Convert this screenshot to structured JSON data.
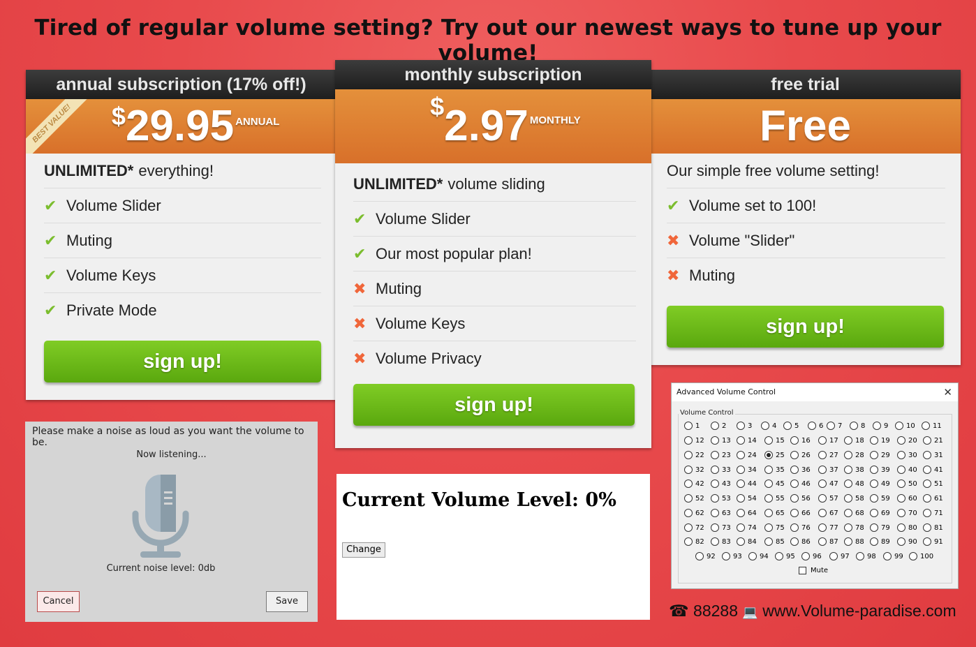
{
  "headline": "Tired of regular volume setting? Try out our newest ways to tune up your volume!",
  "plans": {
    "annual": {
      "title": "annual subscription (17% off!)",
      "currency": "$",
      "amount": "29.95",
      "period": "ANNUAL",
      "ribbon": "BEST VALUE!",
      "intro_bold": "UNLIMITED*",
      "intro_rest": "everything!",
      "features": [
        {
          "icon": "check",
          "label": "Volume Slider"
        },
        {
          "icon": "check",
          "label": "Muting"
        },
        {
          "icon": "check",
          "label": "Volume Keys"
        },
        {
          "icon": "check",
          "label": "Private Mode"
        }
      ],
      "button": "sign up!"
    },
    "monthly": {
      "title": "monthly subscription",
      "currency": "$",
      "amount": "2.97",
      "period": "MONTHLY",
      "intro_bold": "UNLIMITED*",
      "intro_rest": "volume sliding",
      "features": [
        {
          "icon": "check",
          "label": "Volume Slider"
        },
        {
          "icon": "check",
          "label": "Our most popular plan!"
        },
        {
          "icon": "cross",
          "label": "Muting"
        },
        {
          "icon": "cross",
          "label": "Volume Keys"
        },
        {
          "icon": "cross",
          "label": "Volume Privacy"
        }
      ],
      "button": "sign up!"
    },
    "free": {
      "title": "free trial",
      "price_word": "Free",
      "intro": "Our simple free volume setting!",
      "features": [
        {
          "icon": "check",
          "label": "Volume set to 100!"
        },
        {
          "icon": "cross",
          "label": "Volume \"Slider\""
        },
        {
          "icon": "cross",
          "label": "Muting"
        }
      ],
      "button": "sign up!"
    }
  },
  "mic_dialog": {
    "prompt": "Please make a noise as loud as you want the volume to be.",
    "status": "Now listening...",
    "level": "Current noise level: 0db",
    "cancel": "Cancel",
    "save": "Save"
  },
  "current_volume": {
    "title": "Current Volume Level: 0%",
    "button": "Change"
  },
  "advanced": {
    "title": "Advanced Volume Control",
    "group_label": "Volume Control",
    "selected": 25,
    "mute_label": "Mute",
    "mute_checked": false
  },
  "contact": {
    "phone_icon": "☎",
    "phone": "88288",
    "web_icon": "💻",
    "website": "www.Volume-paradise.com"
  },
  "colors": {
    "background": "#e84a4c",
    "price_band": "#dd7a30",
    "signup_green": "#6cbb18",
    "check": "#7bbd2e",
    "cross": "#f0663a"
  }
}
